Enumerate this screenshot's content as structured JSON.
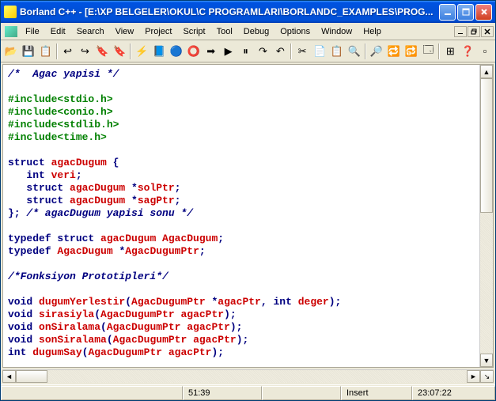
{
  "title": "Borland C++ - [E:\\XP BELGELER\\OKUL\\C PROGRAMLARI\\BORLANDC_EXAMPLES\\PROG...",
  "menus": [
    "File",
    "Edit",
    "Search",
    "View",
    "Project",
    "Script",
    "Tool",
    "Debug",
    "Options",
    "Window",
    "Help"
  ],
  "toolbar_icons": [
    [
      "open-file-icon",
      "save-file-icon",
      "save-all-icon"
    ],
    [
      "jump-back-icon",
      "jump-fwd-icon",
      "bookmark1-icon",
      "bookmark2-icon"
    ],
    [
      "compile-icon",
      "make-icon",
      "build-icon",
      "stop-icon",
      "run-icon",
      "debug-icon",
      "pause-icon",
      "step-over-icon",
      "step-into-icon"
    ],
    [
      "undo-icon",
      "cut-icon",
      "copy-icon",
      "paste-icon"
    ],
    [
      "find-icon",
      "find-next-icon",
      "replace-icon",
      "replace-next-icon"
    ],
    [
      "new-win-icon",
      "cascade-icon",
      "help-icon"
    ]
  ],
  "code": [
    [
      {
        "t": "/*  Agac yapisi */",
        "c": "cmt"
      }
    ],
    [],
    [
      {
        "t": "#include<stdio.h>",
        "c": "str"
      }
    ],
    [
      {
        "t": "#include<conio.h>",
        "c": "str"
      }
    ],
    [
      {
        "t": "#include<stdlib.h>",
        "c": "str"
      }
    ],
    [
      {
        "t": "#include<time.h>",
        "c": "str"
      }
    ],
    [],
    [
      {
        "t": "struct ",
        "c": "kw"
      },
      {
        "t": "agacDugum",
        "c": "id"
      },
      {
        "t": " {",
        "c": "pun"
      }
    ],
    [
      {
        "t": "   int ",
        "c": "kw"
      },
      {
        "t": "veri",
        "c": "id"
      },
      {
        "t": ";",
        "c": "pun"
      }
    ],
    [
      {
        "t": "   struct ",
        "c": "kw"
      },
      {
        "t": "agacDugum",
        "c": "id"
      },
      {
        "t": " *",
        "c": "pun"
      },
      {
        "t": "solPtr",
        "c": "id"
      },
      {
        "t": ";",
        "c": "pun"
      }
    ],
    [
      {
        "t": "   struct ",
        "c": "kw"
      },
      {
        "t": "agacDugum",
        "c": "id"
      },
      {
        "t": " *",
        "c": "pun"
      },
      {
        "t": "sagPtr",
        "c": "id"
      },
      {
        "t": ";",
        "c": "pun"
      }
    ],
    [
      {
        "t": "}; ",
        "c": "pun"
      },
      {
        "t": "/* agacDugum yapisi sonu */",
        "c": "cmt"
      }
    ],
    [],
    [
      {
        "t": "typedef struct ",
        "c": "kw"
      },
      {
        "t": "agacDugum AgacDugum",
        "c": "id"
      },
      {
        "t": ";",
        "c": "pun"
      }
    ],
    [
      {
        "t": "typedef ",
        "c": "kw"
      },
      {
        "t": "AgacDugum",
        "c": "id"
      },
      {
        "t": " *",
        "c": "pun"
      },
      {
        "t": "AgacDugumPtr",
        "c": "id"
      },
      {
        "t": ";",
        "c": "pun"
      }
    ],
    [],
    [
      {
        "t": "/*Fonksiyon Prototipleri*/",
        "c": "cmt"
      }
    ],
    [],
    [
      {
        "t": "void ",
        "c": "kw"
      },
      {
        "t": "dugumYerlestir",
        "c": "id"
      },
      {
        "t": "(",
        "c": "pun"
      },
      {
        "t": "AgacDugumPtr",
        "c": "id"
      },
      {
        "t": " *",
        "c": "pun"
      },
      {
        "t": "agacPtr",
        "c": "id"
      },
      {
        "t": ", ",
        "c": "pun"
      },
      {
        "t": "int ",
        "c": "kw"
      },
      {
        "t": "deger",
        "c": "id"
      },
      {
        "t": ");",
        "c": "pun"
      }
    ],
    [
      {
        "t": "void ",
        "c": "kw"
      },
      {
        "t": "sirasiyla",
        "c": "id"
      },
      {
        "t": "(",
        "c": "pun"
      },
      {
        "t": "AgacDugumPtr agacPtr",
        "c": "id"
      },
      {
        "t": ");",
        "c": "pun"
      }
    ],
    [
      {
        "t": "void ",
        "c": "kw"
      },
      {
        "t": "onSiralama",
        "c": "id"
      },
      {
        "t": "(",
        "c": "pun"
      },
      {
        "t": "AgacDugumPtr agacPtr",
        "c": "id"
      },
      {
        "t": ");",
        "c": "pun"
      }
    ],
    [
      {
        "t": "void ",
        "c": "kw"
      },
      {
        "t": "sonSiralama",
        "c": "id"
      },
      {
        "t": "(",
        "c": "pun"
      },
      {
        "t": "AgacDugumPtr agacPtr",
        "c": "id"
      },
      {
        "t": ");",
        "c": "pun"
      }
    ],
    [
      {
        "t": "int ",
        "c": "kw"
      },
      {
        "t": "dugumSay",
        "c": "id"
      },
      {
        "t": "(",
        "c": "pun"
      },
      {
        "t": "AgacDugumPtr agacPtr",
        "c": "id"
      },
      {
        "t": ");",
        "c": "pun"
      }
    ]
  ],
  "status": {
    "cursor": "51:39",
    "mode": "Insert",
    "time": "23:07:22"
  }
}
